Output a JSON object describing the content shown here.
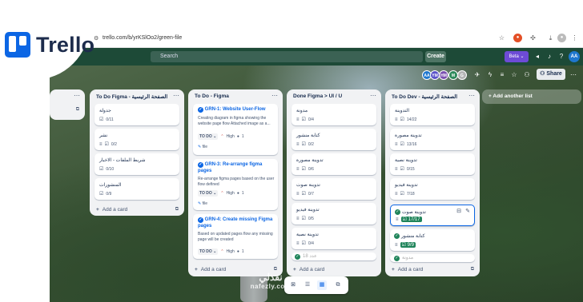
{
  "browser": {
    "url": "trello.com/b/yrKSlOo2/green-file"
  },
  "header": {
    "search_placeholder": "Search",
    "create_label": "Create",
    "beta_label": "Beta",
    "avatar_initials": "AA"
  },
  "logo": {
    "text": "Trello"
  },
  "board_bar": {
    "members": [
      "AA",
      "YM",
      "HM",
      "M",
      "G"
    ],
    "share_label": "Share"
  },
  "lists": [
    {
      "title": "",
      "cards": []
    },
    {
      "title": "To Do Figma - الصفحة الرئيسية",
      "cards": [
        {
          "title": "جدولة",
          "checklist": "0/11"
        },
        {
          "title": "نشر",
          "checklist": "0/2"
        },
        {
          "title": "شريط الملفات - الاخبار",
          "checklist": "0/10"
        },
        {
          "title": "المنشورات",
          "checklist": "0/9"
        }
      ],
      "add_card": "Add a card"
    },
    {
      "title": "To Do - Figma",
      "cards": [
        {
          "title": "GRN-1: Website User-Flow",
          "desc": "Creating diagram in figma showing the website page flow Attached image as a...",
          "status": "TO DO",
          "priority": "High",
          "count": "1",
          "tag": "file"
        },
        {
          "title": "GRN-3: Re-arrange figma pages",
          "desc": "Re-arrange figma pages based on the user flow defined",
          "status": "TO DO",
          "priority": "High",
          "count": "1",
          "tag": "file"
        },
        {
          "title": "GRN-4: Create missing Figma pages",
          "desc": "Based on updated pages flow any missing page will be created",
          "status": "TO DO",
          "priority": "High",
          "count": "1"
        }
      ],
      "add_card": "Add a card"
    },
    {
      "title": "Done Figma > UI / U",
      "cards": [
        {
          "title": "مدونة",
          "checklist": "0/4"
        },
        {
          "title": "كتابة منشور",
          "checklist": "0/2"
        },
        {
          "title": "تدوينة مصورة",
          "checklist": "0/6"
        },
        {
          "title": "تدوينة صوت",
          "checklist": "0/7"
        },
        {
          "title": "تدوينة فيديو",
          "checklist": "0/5"
        },
        {
          "title": "تدوينة نصية",
          "checklist": "0/4"
        },
        {
          "title": "عدد 18",
          "checklist": ""
        }
      ],
      "add_card": "Add a card"
    },
    {
      "title": "To Do Dev - الصفحة الرئيسية",
      "cards": [
        {
          "title": "التدوينة",
          "checklist": "14/22"
        },
        {
          "title": "تدوينة مصورة",
          "checklist": "13/16"
        },
        {
          "title": "تدوينة نصية",
          "checklist": "0/15"
        },
        {
          "title": "تدوينة فيديو",
          "checklist": "7/18"
        },
        {
          "title": "تدوينة صوت",
          "checklist": "17/17"
        },
        {
          "title": "كتابة منشور",
          "checklist": "9/9"
        },
        {
          "title": "مدونة",
          "checklist": ""
        }
      ],
      "add_card": "Add a card"
    }
  ],
  "add_list_label": "Add another list",
  "watermark": {
    "arabic": "نفذلي",
    "latin": "nafezly.com"
  }
}
